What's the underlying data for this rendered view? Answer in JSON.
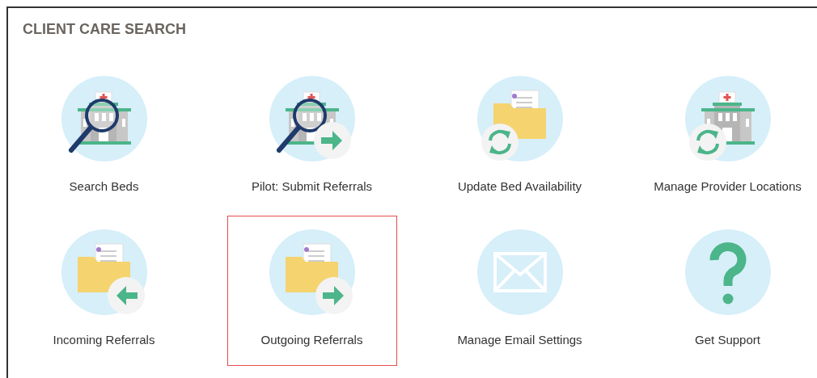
{
  "panel": {
    "title": "CLIENT CARE SEARCH"
  },
  "tiles": [
    {
      "label": "Search Beds",
      "kind": "hospital-search",
      "selected": false
    },
    {
      "label": "Pilot: Submit Referrals",
      "kind": "hospital-search-send",
      "selected": false
    },
    {
      "label": "Update Bed Availability",
      "kind": "folder-refresh",
      "selected": false
    },
    {
      "label": "Manage Provider Locations",
      "kind": "hospital-refresh",
      "selected": false
    },
    {
      "label": "Incoming Referrals",
      "kind": "folder-in",
      "selected": false
    },
    {
      "label": "Outgoing Referrals",
      "kind": "folder-out",
      "selected": true
    },
    {
      "label": "Manage Email Settings",
      "kind": "envelope",
      "selected": false
    },
    {
      "label": "Get Support",
      "kind": "question",
      "selected": false
    }
  ]
}
